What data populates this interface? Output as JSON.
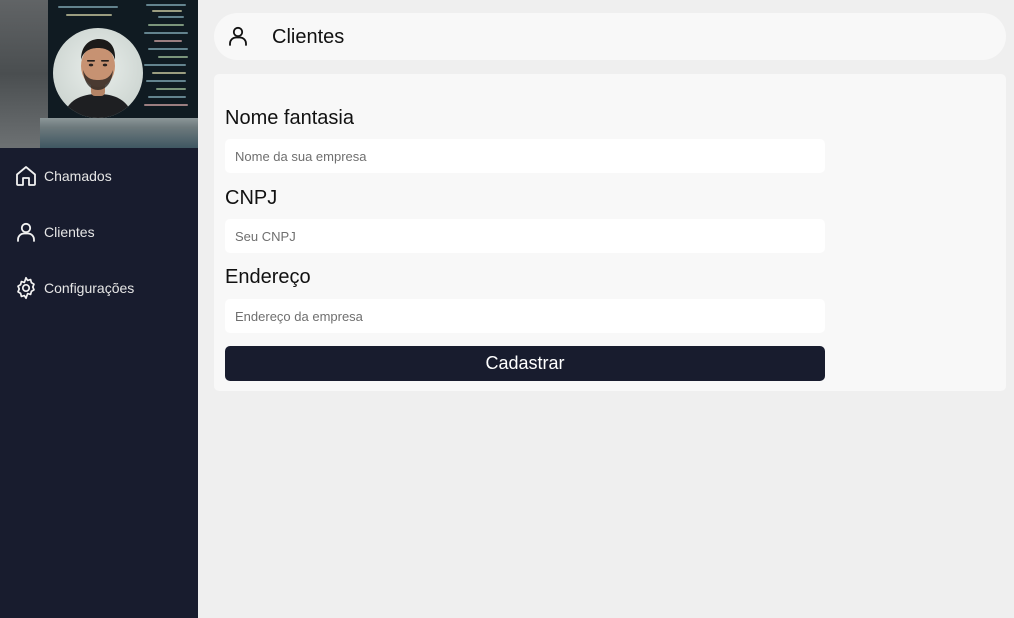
{
  "sidebar": {
    "avatar_icon": "user-photo",
    "items": [
      {
        "label": "Chamados",
        "icon": "home-icon"
      },
      {
        "label": "Clientes",
        "icon": "user-icon"
      },
      {
        "label": "Configurações",
        "icon": "gear-icon"
      }
    ]
  },
  "header": {
    "title": "Clientes",
    "icon": "user-icon"
  },
  "form": {
    "fields": [
      {
        "label": "Nome fantasia",
        "placeholder": "Nome da sua empresa",
        "value": ""
      },
      {
        "label": "CNPJ",
        "placeholder": "Seu CNPJ",
        "value": ""
      },
      {
        "label": "Endereço",
        "placeholder": "Endereço da empresa",
        "value": ""
      }
    ],
    "submit_label": "Cadastrar"
  },
  "colors": {
    "sidebar_bg": "#181c2e",
    "page_bg": "#efefef",
    "card_bg": "#f8f8f8",
    "button_bg": "#181c2e",
    "button_text": "#ffffff"
  }
}
